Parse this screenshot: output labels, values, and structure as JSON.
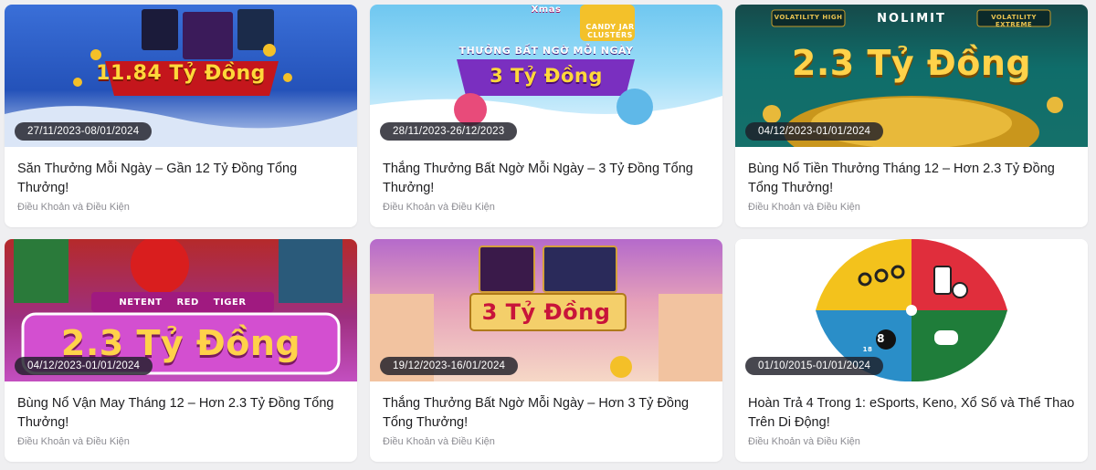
{
  "colors": {
    "page_bg": "#efeff1",
    "card_bg": "#ffffff",
    "badge_bg": "#1e1e28",
    "title_text": "#1d1d1f",
    "terms_text": "#8c8c92"
  },
  "promotions": [
    {
      "banner_headline": "11.84 Tỷ Đồng",
      "date_range": "27/11/2023-08/01/2024",
      "title": "Săn Thưởng Mỗi Ngày – Gần 12 Tỷ Đồng Tổng Thưởng!",
      "terms_link": "Điều Khoản và Điều Kiện"
    },
    {
      "banner_headline": "3 Tỷ Đồng",
      "banner_subheadline": "THƯỞNG BẤT NGỜ MỖI NGÀY",
      "banner_tags": [
        "Xmas",
        "CANDY JAR CLUSTERS"
      ],
      "date_range": "28/11/2023-26/12/2023",
      "title": "Thắng Thưởng Bất Ngờ Mỗi Ngày – 3 Tỷ Đồng Tổng Thưởng!",
      "terms_link": "Điều Khoản và Điều Kiện"
    },
    {
      "banner_headline": "2.3 Tỷ Đồng",
      "banner_brand": "NOLIMIT",
      "banner_tags": [
        "VOLATILITY HIGH",
        "VOLATILITY EXTREME"
      ],
      "date_range": "04/12/2023-01/01/2024",
      "title": "Bùng Nổ Tiền Thưởng Tháng 12 – Hơn 2.3 Tỷ Đồng Tổng Thưởng!",
      "terms_link": "Điều Khoản và Điều Kiện"
    },
    {
      "banner_headline": "2.3 Tỷ Đồng",
      "banner_brands": [
        "NETENT",
        "RED TIGER"
      ],
      "date_range": "04/12/2023-01/01/2024",
      "title": "Bùng Nổ Vận May Tháng 12 – Hơn 2.3 Tỷ Đồng Tổng Thưởng!",
      "terms_link": "Điều Khoản và Điều Kiện"
    },
    {
      "banner_headline": "3 Tỷ Đồng",
      "date_range": "19/12/2023-16/01/2024",
      "title": "Thắng Thưởng Bất Ngờ Mỗi Ngày – Hơn 3 Tỷ Đồng Tổng Thưởng!",
      "terms_link": "Điều Khoản và Điều Kiện"
    },
    {
      "banner_ball_number": "8",
      "banner_small_number": "18",
      "date_range": "01/10/2015-01/01/2024",
      "title": "Hoàn Trả 4 Trong 1: eSports, Keno, Xổ Số và Thể Thao Trên Di Động!",
      "terms_link": "Điều Khoản và Điều Kiện"
    }
  ]
}
